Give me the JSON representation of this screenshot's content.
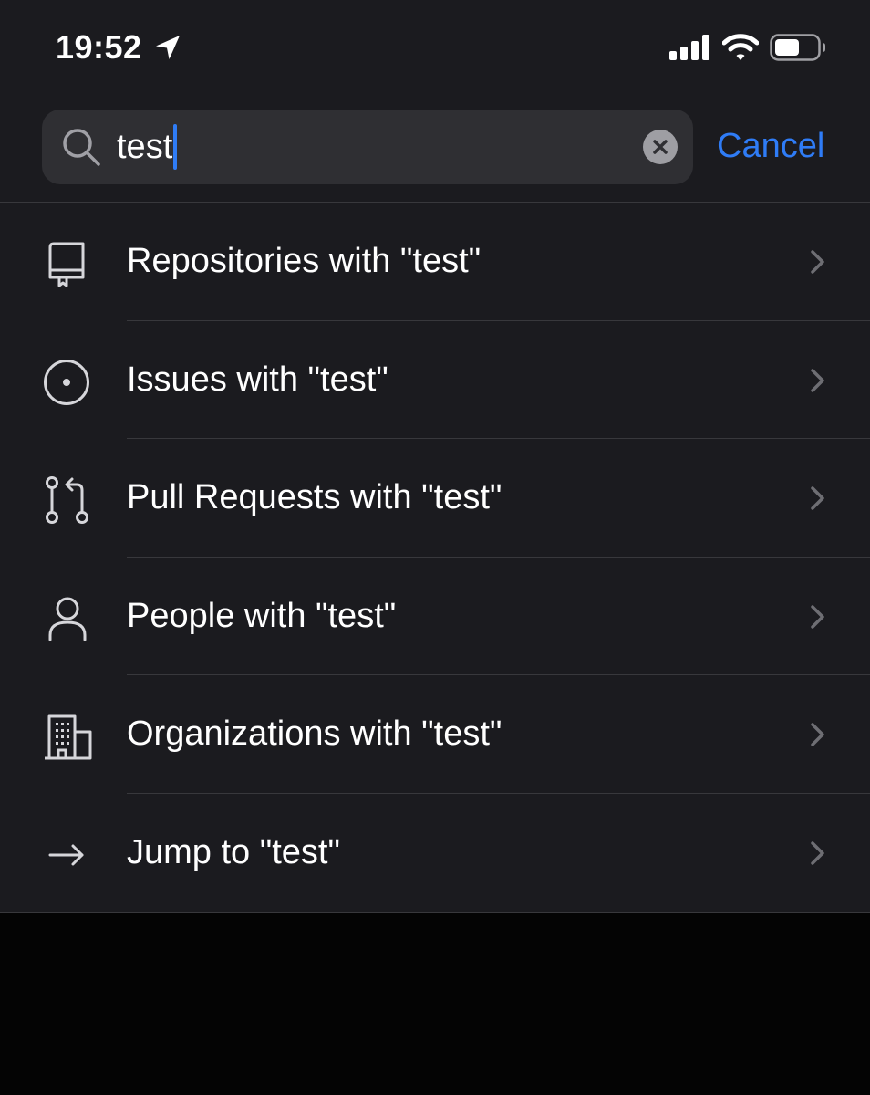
{
  "status_bar": {
    "time": "19:52",
    "icons": [
      "location-arrow-icon",
      "cellular-signal-icon",
      "wifi-icon",
      "battery-icon"
    ]
  },
  "search": {
    "value": "test",
    "cancel_label": "Cancel"
  },
  "results": [
    {
      "icon": "repository-icon",
      "label": "Repositories with \"test\""
    },
    {
      "icon": "issue-icon",
      "label": "Issues with \"test\""
    },
    {
      "icon": "pull-request-icon",
      "label": "Pull Requests with \"test\""
    },
    {
      "icon": "person-icon",
      "label": "People with \"test\""
    },
    {
      "icon": "organization-icon",
      "label": "Organizations with \"test\""
    },
    {
      "icon": "arrow-right-icon",
      "label": "Jump to \"test\""
    }
  ],
  "colors": {
    "background": "#1b1b1f",
    "bottom_area": "#040404",
    "search_field": "#2f2f33",
    "accent": "#2f7cf6",
    "separator": "#38383c",
    "icon_gray": "#d6d6da",
    "chevron_gray": "#6e6e73"
  }
}
